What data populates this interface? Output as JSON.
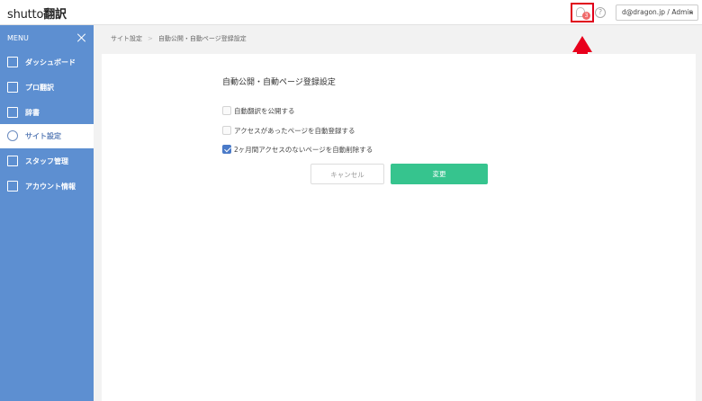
{
  "header": {
    "logo_main": "shutto",
    "logo_sub": "翻訳",
    "badge_count": "3",
    "help_label": "?",
    "user_label": "d@dragon.jp / Admin"
  },
  "sidebar": {
    "menu_label": "MENU",
    "items": [
      {
        "label": "ダッシュボード",
        "icon": "home-icon"
      },
      {
        "label": "プロ翻訳",
        "icon": "grid-icon"
      },
      {
        "label": "辞書",
        "icon": "book-icon"
      },
      {
        "label": "サイト設定",
        "icon": "gear-icon"
      },
      {
        "label": "スタッフ管理",
        "icon": "users-icon"
      },
      {
        "label": "アカウント情報",
        "icon": "document-icon"
      }
    ]
  },
  "breadcrumb": {
    "parent": "サイト設定",
    "current": "自動公開・自動ページ登録設定"
  },
  "form": {
    "title": "自動公開・自動ページ登録設定",
    "options": [
      {
        "label": "自動翻訳を公開する",
        "checked": false
      },
      {
        "label": "アクセスがあったページを自動登録する",
        "checked": false
      },
      {
        "label": "2ヶ月間アクセスのないページを自動削除する",
        "checked": true
      }
    ],
    "cancel_label": "キャンセル",
    "save_label": "変更"
  },
  "colors": {
    "sidebar": "#5d8fd1",
    "save_button": "#36c48e",
    "highlight": "#e8001c"
  }
}
